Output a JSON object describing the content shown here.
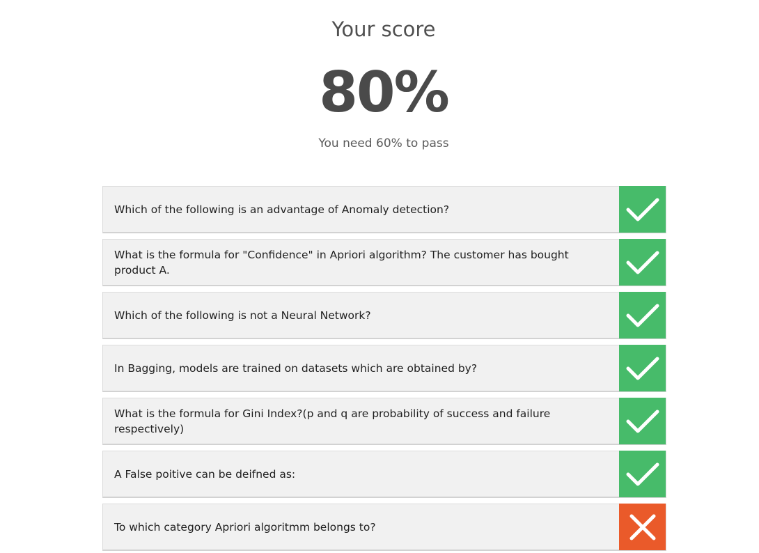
{
  "score": {
    "title": "Your score",
    "value": "80%",
    "pass_note": "You need 60% to pass"
  },
  "colors": {
    "correct": "#47bb6a",
    "incorrect": "#ea5a2a"
  },
  "questions": [
    {
      "text": "Which of the following is an advantage of Anomaly detection?",
      "result": "correct",
      "icon": "check-icon"
    },
    {
      "text": "What is the formula for \"Confidence\" in Apriori algorithm? The customer has bought product A.",
      "result": "correct",
      "icon": "check-icon"
    },
    {
      "text": "Which of the following is not a Neural Network?",
      "result": "correct",
      "icon": "check-icon"
    },
    {
      "text": "In Bagging, models are trained on datasets which are obtained by?",
      "result": "correct",
      "icon": "check-icon"
    },
    {
      "text": "What is the formula for Gini Index?(p and q are probability of success and failure respectively)",
      "result": "correct",
      "icon": "check-icon"
    },
    {
      "text": "A False poitive can be deifned as:",
      "result": "correct",
      "icon": "check-icon"
    },
    {
      "text": "To which category Apriori algoritmm belongs to?",
      "result": "incorrect",
      "icon": "cross-icon"
    }
  ]
}
